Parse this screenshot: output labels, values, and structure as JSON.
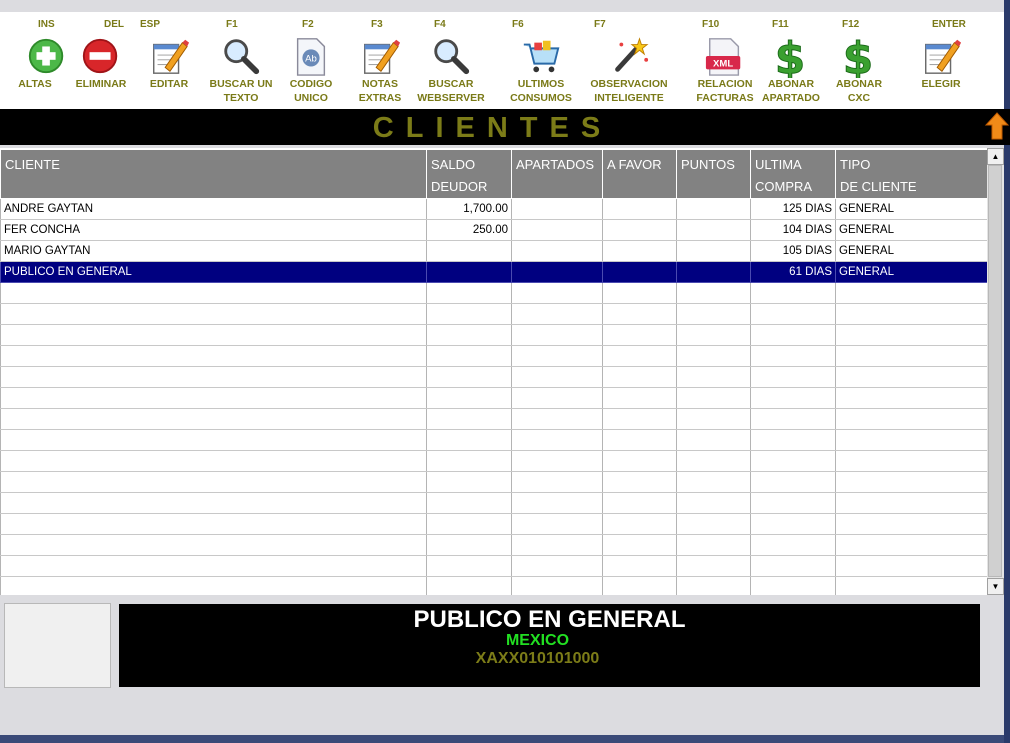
{
  "toolbar": {
    "buttons": [
      {
        "key": "INS",
        "label1": "ALTAS",
        "label2": "",
        "icon": "plus-circle-icon"
      },
      {
        "key": "DEL",
        "label1": "ELIMINAR",
        "label2": "",
        "icon": "minus-circle-icon"
      },
      {
        "key": "ESP",
        "label1": "EDITAR",
        "label2": "",
        "icon": "edit-notepad-icon"
      },
      {
        "key": "F1",
        "label1": "BUSCAR UN",
        "label2": "TEXTO",
        "icon": "magnifier-icon"
      },
      {
        "key": "F2",
        "label1": "CODIGO",
        "label2": "UNICO",
        "icon": "document-ab-icon"
      },
      {
        "key": "F3",
        "label1": "NOTAS",
        "label2": "EXTRAS",
        "icon": "notes-pencil-icon"
      },
      {
        "key": "F4",
        "label1": "BUSCAR",
        "label2": "WEBSERVER",
        "icon": "magnifier-icon"
      },
      {
        "key": "F6",
        "label1": "ULTIMOS",
        "label2": "CONSUMOS",
        "icon": "shopping-cart-icon"
      },
      {
        "key": "F7",
        "label1": "OBSERVACION",
        "label2": "INTELIGENTE",
        "icon": "magic-wand-icon"
      },
      {
        "key": "F10",
        "label1": "RELACION",
        "label2": "FACTURAS",
        "icon": "xml-file-icon"
      },
      {
        "key": "F11",
        "label1": "ABONAR",
        "label2": "APARTADO",
        "icon": "dollar-icon"
      },
      {
        "key": "F12",
        "label1": "ABONAR",
        "label2": "CXC",
        "icon": "dollar-icon"
      },
      {
        "key": "ENTER",
        "label1": "ELEGIR",
        "label2": "",
        "icon": "edit-notepad-icon"
      }
    ]
  },
  "title": "CLIENTES",
  "grid": {
    "columns": [
      {
        "line1": "CLIENTE",
        "line2": ""
      },
      {
        "line1": "SALDO",
        "line2": "DEUDOR"
      },
      {
        "line1": "APARTADOS",
        "line2": ""
      },
      {
        "line1": "A FAVOR",
        "line2": ""
      },
      {
        "line1": "PUNTOS",
        "line2": ""
      },
      {
        "line1": "ULTIMA",
        "line2": "COMPRA"
      },
      {
        "line1": "TIPO",
        "line2": "DE CLIENTE"
      }
    ],
    "rows": [
      [
        "ANDRE GAYTAN",
        "1,700.00",
        "",
        "",
        "",
        "125 DIAS",
        "GENERAL"
      ],
      [
        "FER CONCHA",
        "250.00",
        "",
        "",
        "",
        "104 DIAS",
        "GENERAL"
      ],
      [
        "MARIO GAYTAN",
        "",
        "",
        "",
        "",
        "105 DIAS",
        "GENERAL"
      ],
      [
        "PUBLICO EN GENERAL",
        "",
        "",
        "",
        "",
        "61 DIAS",
        "GENERAL"
      ],
      [
        "",
        "",
        "",
        "",
        "",
        "",
        ""
      ],
      [
        "",
        "",
        "",
        "",
        "",
        "",
        ""
      ],
      [
        "",
        "",
        "",
        "",
        "",
        "",
        ""
      ],
      [
        "",
        "",
        "",
        "",
        "",
        "",
        ""
      ],
      [
        "",
        "",
        "",
        "",
        "",
        "",
        ""
      ],
      [
        "",
        "",
        "",
        "",
        "",
        "",
        ""
      ],
      [
        "",
        "",
        "",
        "",
        "",
        "",
        ""
      ],
      [
        "",
        "",
        "",
        "",
        "",
        "",
        ""
      ],
      [
        "",
        "",
        "",
        "",
        "",
        "",
        ""
      ],
      [
        "",
        "",
        "",
        "",
        "",
        "",
        ""
      ],
      [
        "",
        "",
        "",
        "",
        "",
        "",
        ""
      ],
      [
        "",
        "",
        "",
        "",
        "",
        "",
        ""
      ],
      [
        "",
        "",
        "",
        "",
        "",
        "",
        ""
      ],
      [
        "",
        "",
        "",
        "",
        "",
        "",
        ""
      ],
      [
        "",
        "",
        "",
        "",
        "",
        "",
        ""
      ]
    ],
    "selected_row": 3
  },
  "info": {
    "name": "PUBLICO EN GENERAL",
    "country": "MEXICO",
    "rfc": "XAXX010101000"
  },
  "colors": {
    "olive": "#7c7c18",
    "selection": "#000080",
    "header": "#828282",
    "country": "#22e022"
  }
}
